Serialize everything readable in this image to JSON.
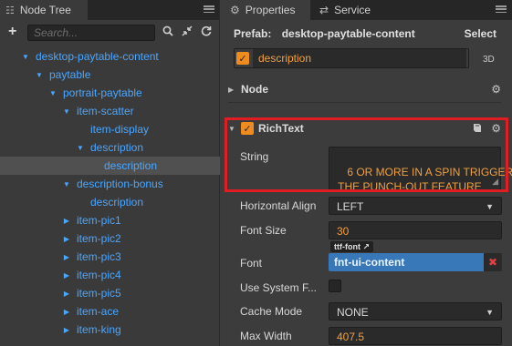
{
  "node_tree": {
    "tab_title": "Node Tree",
    "tab_icon": "node-tree-icon",
    "search_placeholder": "Search...",
    "items": [
      {
        "label": "desktop-paytable-content",
        "depth": 1,
        "expanded": true
      },
      {
        "label": "paytable",
        "depth": 2,
        "expanded": true
      },
      {
        "label": "portrait-paytable",
        "depth": 3,
        "expanded": true
      },
      {
        "label": "item-scatter",
        "depth": 4,
        "expanded": true
      },
      {
        "label": "item-display",
        "depth": 5,
        "expanded": null
      },
      {
        "label": "description",
        "depth": 5,
        "expanded": true
      },
      {
        "label": "description",
        "depth": 6,
        "expanded": null,
        "selected": true
      },
      {
        "label": "description-bonus",
        "depth": 4,
        "expanded": true
      },
      {
        "label": "description",
        "depth": 5,
        "expanded": null
      },
      {
        "label": "item-pic1",
        "depth": 4,
        "expanded": false
      },
      {
        "label": "item-pic2",
        "depth": 4,
        "expanded": false
      },
      {
        "label": "item-pic3",
        "depth": 4,
        "expanded": false
      },
      {
        "label": "item-pic4",
        "depth": 4,
        "expanded": false
      },
      {
        "label": "item-pic5",
        "depth": 4,
        "expanded": false
      },
      {
        "label": "item-ace",
        "depth": 4,
        "expanded": false
      },
      {
        "label": "item-king",
        "depth": 4,
        "expanded": false
      }
    ]
  },
  "inspector": {
    "tabs": [
      {
        "label": "Properties",
        "icon": "gear-icon",
        "active": true
      },
      {
        "label": "Service",
        "icon": "service-icon",
        "active": false
      }
    ],
    "prefab_label": "Prefab:",
    "prefab_name": "desktop-paytable-content",
    "select_label": "Select",
    "node_name": "description",
    "tag_3d": "3D",
    "node_section": "Node",
    "richtext_section": "RichText",
    "props": {
      "string_label": "String",
      "string_value": "6 OR MORE IN A SPIN TRIGGER\n THE PUNCH-OUT FEATURE",
      "halign_label": "Horizontal Align",
      "halign_value": "LEFT",
      "fontsize_label": "Font Size",
      "fontsize_value": "30",
      "font_badge": "ttf-font",
      "font_label": "Font",
      "font_value": "fnt-ui-content",
      "system_font_label": "Use System F...",
      "cache_label": "Cache Mode",
      "cache_value": "NONE",
      "maxwidth_label": "Max Width",
      "maxwidth_value": "407.5"
    }
  },
  "colors": {
    "accent_orange": "#f08c1e",
    "tree_blue": "#4aa6ff",
    "highlight_red": "#e11d24",
    "font_field_blue": "#3878b8"
  }
}
